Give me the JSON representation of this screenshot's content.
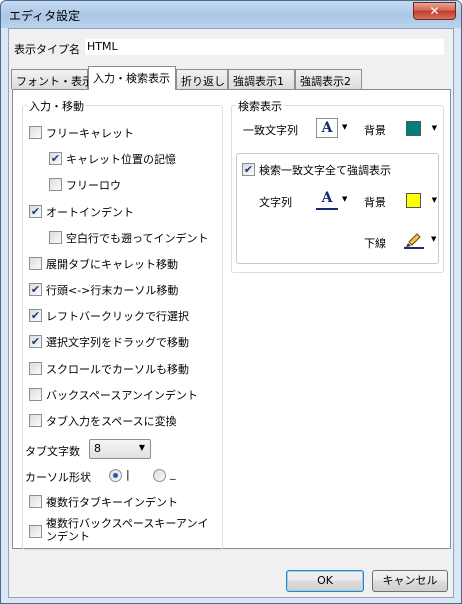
{
  "window": {
    "title": "エディタ設定",
    "close_glyph": "✕"
  },
  "type_name": {
    "label": "表示タイプ名",
    "value": "HTML"
  },
  "tabs": [
    {
      "label": "フォント・表示"
    },
    {
      "label": "入力・検索表示"
    },
    {
      "label": "折り返し"
    },
    {
      "label": "強調表示1"
    },
    {
      "label": "強調表示2"
    }
  ],
  "input_group": {
    "title": "入力・移動",
    "checkboxes": [
      {
        "label": "フリーキャレット",
        "checked": false
      },
      {
        "label": "キャレット位置の記憶",
        "checked": true
      },
      {
        "label": "フリーロウ",
        "checked": false
      },
      {
        "label": "オートインデント",
        "checked": true
      },
      {
        "label": "空白行でも遡ってインデント",
        "checked": false
      },
      {
        "label": "展開タブにキャレット移動",
        "checked": false
      },
      {
        "label": "行頭<->行末カーソル移動",
        "checked": true
      },
      {
        "label": "レフトバークリックで行選択",
        "checked": true
      },
      {
        "label": "選択文字列をドラッグで移動",
        "checked": true
      },
      {
        "label": "スクロールでカーソルも移動",
        "checked": false
      },
      {
        "label": "バックスペースアンインデント",
        "checked": false
      },
      {
        "label": "タブ入力をスペースに変換",
        "checked": false
      }
    ],
    "tab_width": {
      "label": "タブ文字数",
      "value": "8"
    },
    "cursor_shape": {
      "label": "カーソル形状",
      "options": [
        {
          "label": "|",
          "selected": true
        },
        {
          "label": "_",
          "selected": false
        }
      ]
    },
    "checkboxes_bottom": [
      {
        "label": "複数行タブキーインデント",
        "checked": false
      },
      {
        "label": "複数行バックスペースキーアンインデント",
        "checked": false
      }
    ]
  },
  "search_group": {
    "title": "検索表示",
    "match_text_label": "一致文字列",
    "background_label": "背景",
    "match_bg_color": "#007f7f",
    "highlight_all": {
      "label": "検索一致文字全て強調表示",
      "checked": true
    },
    "string_label": "文字列",
    "highlight_bg_color": "#ffff00",
    "underline_label": "下線"
  },
  "buttons": {
    "ok": "OK",
    "cancel": "キャンセル"
  },
  "check_glyph": "✔",
  "dropdown_glyph": "▼"
}
